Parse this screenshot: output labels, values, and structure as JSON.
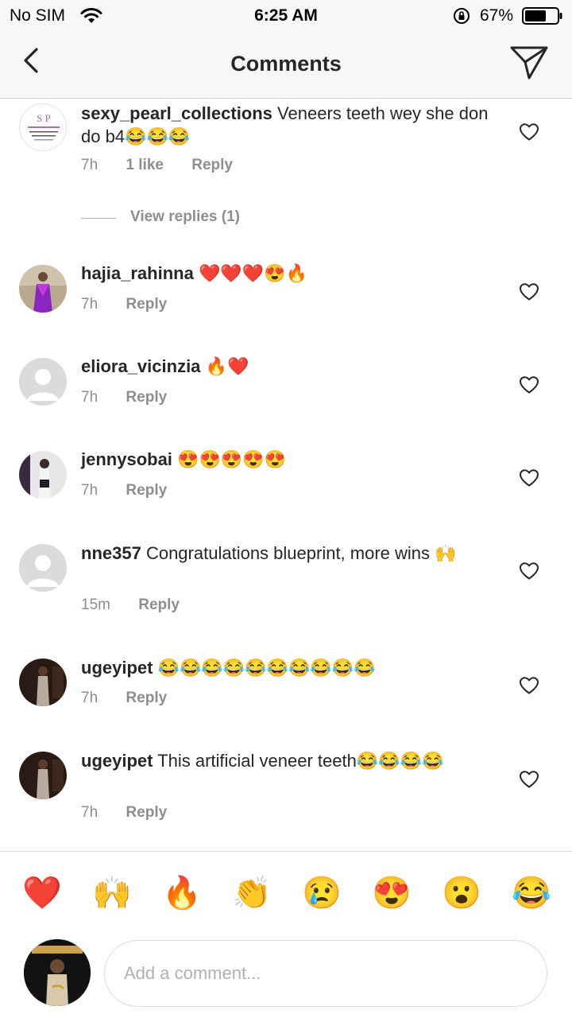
{
  "status_bar": {
    "carrier": "No SIM",
    "time": "6:25 AM",
    "battery_pct": "67%",
    "battery_level": 0.67
  },
  "header": {
    "title": "Comments",
    "back_icon": "chevron-left-icon",
    "send_icon": "paper-plane-icon"
  },
  "comments": [
    {
      "user": "sexy_pearl_collections",
      "text": "Veneers teeth wey she don do b4😂😂😂",
      "time": "7h",
      "likes": "1 like",
      "reply": "Reply",
      "avatar": "logo"
    },
    {
      "user": "hajia_rahinna",
      "text": "❤️❤️❤️😍🔥",
      "time": "7h",
      "reply": "Reply",
      "avatar": "photo-purple"
    },
    {
      "user": "eliora_vicinzia",
      "text": "🔥❤️",
      "time": "7h",
      "reply": "Reply",
      "avatar": "default"
    },
    {
      "user": "jennysobai",
      "text": "😍😍😍😍😍",
      "time": "7h",
      "reply": "Reply",
      "avatar": "photo-light"
    },
    {
      "user": "nne357",
      "text": "Congratulations blueprint, more wins 🙌",
      "time": "15m",
      "reply": "Reply",
      "avatar": "default"
    },
    {
      "user": "ugeyipet",
      "text": "😂😂😂😂😂😂😂😂😂😂",
      "time": "7h",
      "reply": "Reply",
      "avatar": "photo-dark"
    },
    {
      "user": "ugeyipet",
      "text": "This artificial veneer teeth😂😂😂😂",
      "time": "7h",
      "reply": "Reply",
      "avatar": "photo-dark"
    }
  ],
  "view_replies": "View replies (1)",
  "quick_emojis": [
    "❤️",
    "🙌",
    "🔥",
    "👏",
    "😢",
    "😍",
    "😮",
    "😂"
  ],
  "composer": {
    "placeholder": "Add a comment..."
  },
  "colors": {
    "text": "#262626",
    "muted": "#8e8e8e",
    "heart_outline": "#262626"
  }
}
